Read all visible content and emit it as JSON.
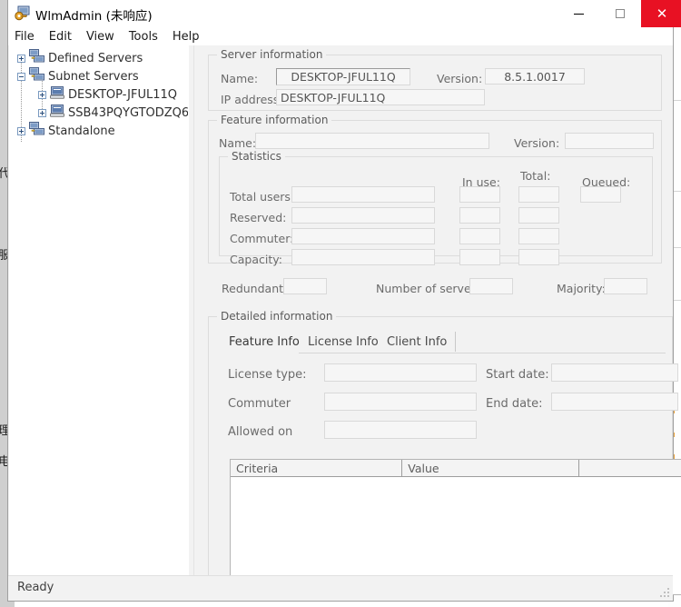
{
  "window": {
    "title": "WlmAdmin (未响应)",
    "icon": "wlmadmin-app-icon",
    "controls": {
      "minimize": "—",
      "maximize": "□",
      "close": "✕"
    }
  },
  "menu": {
    "items": [
      {
        "label": "File"
      },
      {
        "label": "Edit"
      },
      {
        "label": "View"
      },
      {
        "label": "Tools"
      },
      {
        "label": "Help"
      }
    ]
  },
  "tree": {
    "nodes": [
      {
        "label": "Defined Servers",
        "expander": "plus",
        "icon": "servers-icon",
        "indent": 0
      },
      {
        "label": "Subnet Servers",
        "expander": "minus",
        "icon": "servers-icon",
        "indent": 0
      },
      {
        "label": "DESKTOP-JFUL11Q",
        "expander": "plus",
        "icon": "computer-icon",
        "indent": 1
      },
      {
        "label": "SSB43PQYGTODZQ6",
        "expander": "plus",
        "icon": "computer-icon",
        "indent": 1
      },
      {
        "label": "Standalone",
        "expander": "plus",
        "icon": "servers-icon",
        "indent": 0
      }
    ]
  },
  "server_information": {
    "legend": "Server information",
    "name_label": "Name:",
    "name_value": "DESKTOP-JFUL11Q",
    "version_label": "Version:",
    "version_value": "8.5.1.0017",
    "ip_label": "IP address:",
    "ip_value": "DESKTOP-JFUL11Q"
  },
  "feature_information": {
    "legend": "Feature information",
    "name_label": "Name:",
    "name_value": "",
    "version_label": "Version:",
    "version_value": ""
  },
  "statistics": {
    "legend": "Statistics",
    "columns": {
      "in_use": "In use:",
      "total": "Total:",
      "queued": "Queued:"
    },
    "rows": [
      {
        "label": "Total users:",
        "main": "",
        "in_use": "",
        "total": "",
        "queued": ""
      },
      {
        "label": "Reserved:",
        "main": "",
        "in_use": "",
        "total": ""
      },
      {
        "label": "Commuter:",
        "main": "",
        "in_use": "",
        "total": ""
      },
      {
        "label": "Capacity:",
        "main": "",
        "in_use": "",
        "total": ""
      }
    ]
  },
  "server_footer": {
    "redundant_label": "Redundant:",
    "redundant_value": "",
    "servers_label": "Number of servers:",
    "servers_value": "",
    "majority_label": "Majority:",
    "majority_value": ""
  },
  "detailed_information": {
    "legend": "Detailed information",
    "tabs": [
      {
        "label": "Feature Info",
        "active": true
      },
      {
        "label": "License Info",
        "active": false
      },
      {
        "label": "Client Info",
        "active": false
      }
    ],
    "fields": {
      "license_type_label": "License type:",
      "license_type_value": "",
      "start_date_label": "Start date:",
      "start_date_value": "",
      "commuter_label": "Commuter",
      "commuter_value": "",
      "end_date_label": "End date:",
      "end_date_value": "",
      "allowed_on_label": "Allowed on",
      "allowed_on_value": ""
    },
    "table": {
      "columns": [
        "Criteria",
        "Value",
        ""
      ],
      "rows": []
    }
  },
  "status_bar": {
    "text": "Ready"
  },
  "background": {
    "left_fragments": [
      "代",
      "服",
      "理",
      "电"
    ]
  },
  "colors": {
    "close_button": "#e81123",
    "window_chrome": "#f0f0f0",
    "field_background": "#f6f6f6",
    "accent_orange": "#e9a23b"
  }
}
